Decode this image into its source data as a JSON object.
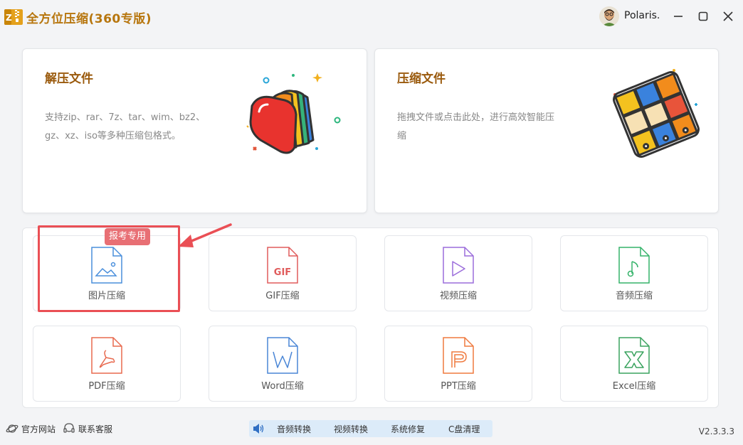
{
  "app": {
    "title": "全方位压缩(360专版)",
    "logo_icon": "zip-archive-icon",
    "brand_color": "#b7760e"
  },
  "user": {
    "name": "Polaris.",
    "avatar_icon": "user-avatar-icon"
  },
  "window_controls": {
    "minimize_icon": "minimize-icon",
    "maximize_icon": "maximize-icon",
    "close_icon": "close-icon"
  },
  "cards": {
    "extract": {
      "title": "解压文件",
      "desc_line1": "支持zip、rar、7z、tar、wim、bz2、",
      "desc_line2": "gz、xz、iso等多种压缩包格式。",
      "icon": "open-folder-icon"
    },
    "compress": {
      "title": "压缩文件",
      "desc_line1": "拖拽文件或点击此处，进行高效智能压",
      "desc_line2": "缩",
      "icon": "archive-binder-icon"
    }
  },
  "tools": [
    {
      "label": "图片压缩",
      "icon": "image-file-icon",
      "color": "#4a8fdc"
    },
    {
      "label": "GIF压缩",
      "icon": "gif-file-icon",
      "color": "#e05b5b"
    },
    {
      "label": "视频压缩",
      "icon": "video-file-icon",
      "color": "#9b6ddb"
    },
    {
      "label": "音频压缩",
      "icon": "audio-file-icon",
      "color": "#35b36a"
    },
    {
      "label": "PDF压缩",
      "icon": "pdf-file-icon",
      "color": "#e86a4f"
    },
    {
      "label": "Word压缩",
      "icon": "word-file-icon",
      "color": "#4a86d6"
    },
    {
      "label": "PPT压缩",
      "icon": "ppt-file-icon",
      "color": "#ef7a3f"
    },
    {
      "label": "Excel压缩",
      "icon": "excel-file-icon",
      "color": "#3aa35f"
    }
  ],
  "annotation": {
    "tag": "报考专用",
    "color": "#ea4f55"
  },
  "footer": {
    "website": "官方网站",
    "website_icon": "planet-icon",
    "support": "联系客服",
    "support_icon": "headset-icon",
    "quickbar_icon": "speaker-icon",
    "quick": [
      "音频转换",
      "视频转换",
      "系统修复",
      "C盘清理"
    ],
    "version": "V2.3.3.3"
  }
}
